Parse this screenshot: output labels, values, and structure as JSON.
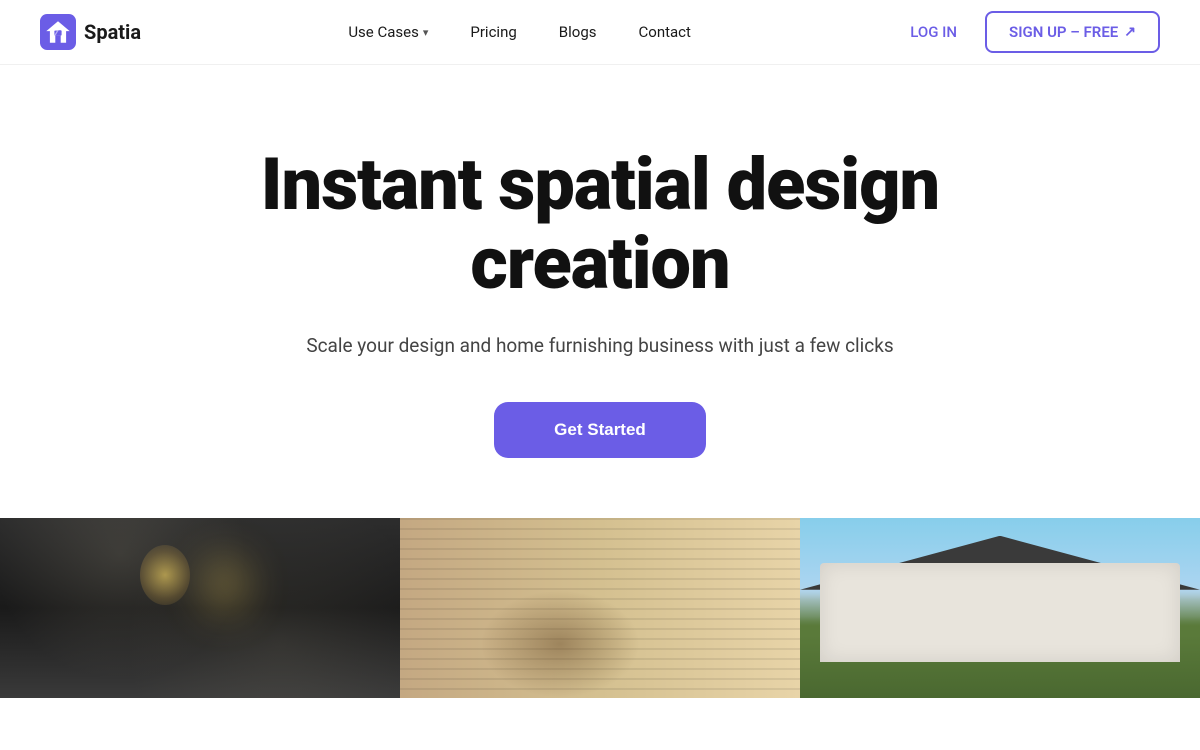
{
  "brand": {
    "name": "Spatia",
    "logo_alt": "Spatia logo"
  },
  "nav": {
    "use_cases_label": "Use Cases",
    "pricing_label": "Pricing",
    "blogs_label": "Blogs",
    "contact_label": "Contact",
    "login_label": "LOG IN",
    "signup_label": "SIGN UP  –  FREE",
    "signup_arrow": "↗"
  },
  "hero": {
    "title": "Instant spatial design creation",
    "subtitle": "Scale your design and home furnishing business with just a few clicks",
    "cta_label": "Get Started"
  },
  "gallery": {
    "image1_alt": "Modern dark kitchen interior",
    "image2_alt": "Living room with wooden blinds and bookshelves",
    "image3_alt": "House exterior with green lawn"
  },
  "colors": {
    "accent": "#6b5de6",
    "text_dark": "#111111",
    "text_muted": "#444444",
    "nav_border": "#f0f0f0"
  }
}
